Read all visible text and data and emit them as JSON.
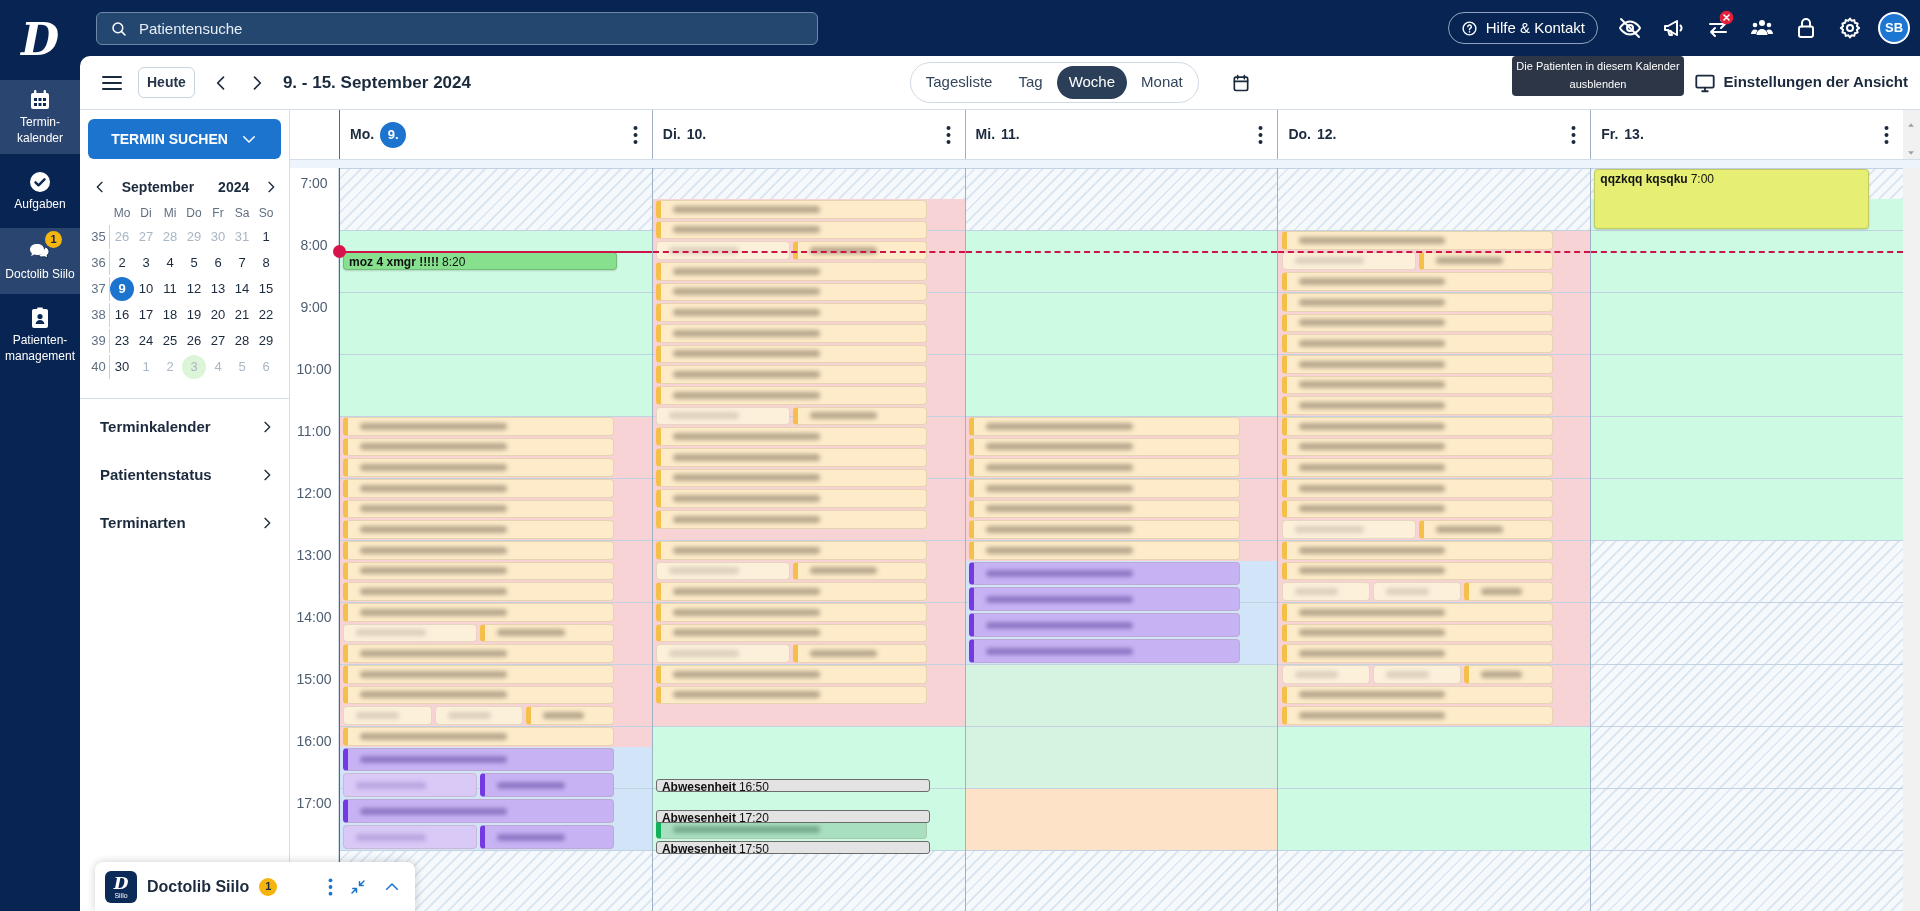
{
  "nav": {
    "logo": "D"
  },
  "nav_items": [
    {
      "kind": "calendar",
      "label": "Termin-\nkalender",
      "selected": true
    },
    {
      "kind": "tasks",
      "label": "Aufgaben",
      "selected": false
    },
    {
      "kind": "chat",
      "label": "Doctolib Siilo",
      "selected": true,
      "badge": "1"
    },
    {
      "kind": "patients",
      "label": "Patienten-\nmanagement",
      "selected": false
    }
  ],
  "search": {
    "placeholder": "Patientensuche"
  },
  "help_button": {
    "label": "Hilfe & Kontakt"
  },
  "header_icons": [
    {
      "kind": "eye-off",
      "alert": false
    },
    {
      "kind": "megaphone",
      "alert": false
    },
    {
      "kind": "swap",
      "alert": true
    },
    {
      "kind": "team",
      "alert": false
    },
    {
      "kind": "lock",
      "alert": false
    },
    {
      "kind": "settings",
      "alert": false
    }
  ],
  "avatar": {
    "initials": "SB"
  },
  "tooltip": {
    "lines": [
      "Die Patienten in diesem Kalender",
      "ausblenden"
    ]
  },
  "toolbar": {
    "today_button": "Heute",
    "range_title": "9. - 15. September 2024",
    "views": [
      {
        "label": "Tagesliste",
        "selected": false
      },
      {
        "label": "Tag",
        "selected": false
      },
      {
        "label": "Woche",
        "selected": true
      },
      {
        "label": "Monat",
        "selected": false
      }
    ],
    "view_settings": "Einstellungen der Ansicht"
  },
  "search_button": {
    "label": "TERMIN SUCHEN"
  },
  "mini_calendar": {
    "month": "September",
    "year": "2024",
    "weekdays": [
      "Mo",
      "Di",
      "Mi",
      "Do",
      "Fr",
      "Sa",
      "So"
    ],
    "weeks": [
      {
        "number": "35",
        "days": [
          {
            "label": "26",
            "outside": true,
            "selected": false,
            "highlighted": false
          },
          {
            "label": "27",
            "outside": true,
            "selected": false,
            "highlighted": false
          },
          {
            "label": "28",
            "outside": true,
            "selected": false,
            "highlighted": false
          },
          {
            "label": "29",
            "outside": true,
            "selected": false,
            "highlighted": false
          },
          {
            "label": "30",
            "outside": true,
            "selected": false,
            "highlighted": false
          },
          {
            "label": "31",
            "outside": true,
            "selected": false,
            "highlighted": false
          },
          {
            "label": "1",
            "outside": false,
            "selected": false,
            "highlighted": false
          }
        ]
      },
      {
        "number": "36",
        "days": [
          {
            "label": "2",
            "outside": false,
            "selected": false,
            "highlighted": false
          },
          {
            "label": "3",
            "outside": false,
            "selected": false,
            "highlighted": false
          },
          {
            "label": "4",
            "outside": false,
            "selected": false,
            "highlighted": false
          },
          {
            "label": "5",
            "outside": false,
            "selected": false,
            "highlighted": false
          },
          {
            "label": "6",
            "outside": false,
            "selected": false,
            "highlighted": false
          },
          {
            "label": "7",
            "outside": false,
            "selected": false,
            "highlighted": false
          },
          {
            "label": "8",
            "outside": false,
            "selected": false,
            "highlighted": false
          }
        ]
      },
      {
        "number": "37",
        "days": [
          {
            "label": "9",
            "outside": false,
            "selected": true,
            "highlighted": false
          },
          {
            "label": "10",
            "outside": false,
            "selected": false,
            "highlighted": false
          },
          {
            "label": "11",
            "outside": false,
            "selected": false,
            "highlighted": false
          },
          {
            "label": "12",
            "outside": false,
            "selected": false,
            "highlighted": false
          },
          {
            "label": "13",
            "outside": false,
            "selected": false,
            "highlighted": false
          },
          {
            "label": "14",
            "outside": false,
            "selected": false,
            "highlighted": false
          },
          {
            "label": "15",
            "outside": false,
            "selected": false,
            "highlighted": false
          }
        ]
      },
      {
        "number": "38",
        "days": [
          {
            "label": "16",
            "outside": false,
            "selected": false,
            "highlighted": false
          },
          {
            "label": "17",
            "outside": false,
            "selected": false,
            "highlighted": false
          },
          {
            "label": "18",
            "outside": false,
            "selected": false,
            "highlighted": false
          },
          {
            "label": "19",
            "outside": false,
            "selected": false,
            "highlighted": false
          },
          {
            "label": "20",
            "outside": false,
            "selected": false,
            "highlighted": false
          },
          {
            "label": "21",
            "outside": false,
            "selected": false,
            "highlighted": false
          },
          {
            "label": "22",
            "outside": false,
            "selected": false,
            "highlighted": false
          }
        ]
      },
      {
        "number": "39",
        "days": [
          {
            "label": "23",
            "outside": false,
            "selected": false,
            "highlighted": false
          },
          {
            "label": "24",
            "outside": false,
            "selected": false,
            "highlighted": false
          },
          {
            "label": "25",
            "outside": false,
            "selected": false,
            "highlighted": false
          },
          {
            "label": "26",
            "outside": false,
            "selected": false,
            "highlighted": false
          },
          {
            "label": "27",
            "outside": false,
            "selected": false,
            "highlighted": false
          },
          {
            "label": "28",
            "outside": false,
            "selected": false,
            "highlighted": false
          },
          {
            "label": "29",
            "outside": false,
            "selected": false,
            "highlighted": false
          }
        ]
      },
      {
        "number": "40",
        "days": [
          {
            "label": "30",
            "outside": false,
            "selected": false,
            "highlighted": false
          },
          {
            "label": "1",
            "outside": true,
            "selected": false,
            "highlighted": false
          },
          {
            "label": "2",
            "outside": true,
            "selected": false,
            "highlighted": false
          },
          {
            "label": "3",
            "outside": true,
            "selected": false,
            "highlighted": true
          },
          {
            "label": "4",
            "outside": true,
            "selected": false,
            "highlighted": false
          },
          {
            "label": "5",
            "outside": true,
            "selected": false,
            "highlighted": false
          },
          {
            "label": "6",
            "outside": true,
            "selected": false,
            "highlighted": false
          }
        ]
      }
    ]
  },
  "sections": [
    {
      "label": "Terminkalender"
    },
    {
      "label": "Patientenstatus"
    },
    {
      "label": "Terminarten"
    }
  ],
  "calendar": {
    "hours": [
      "7:00",
      "8:00",
      "9:00",
      "10:00",
      "11:00",
      "12:00",
      "13:00",
      "14:00",
      "15:00",
      "16:00",
      "17:00"
    ],
    "days": [
      {
        "weekday": "Mo.",
        "date": "9.",
        "today": true,
        "events": [
          {
            "kind": "note",
            "color": "#86e08e",
            "title": "moz 4 xmgr !!!!!",
            "time": "8:20"
          }
        ]
      },
      {
        "weekday": "Di.",
        "date": "10.",
        "today": false,
        "events": [
          {
            "kind": "absence",
            "title": "Abwesenheit",
            "time": "16:50"
          },
          {
            "kind": "absence",
            "title": "Abwesenheit",
            "time": "17:20"
          },
          {
            "kind": "absence",
            "title": "Abwesenheit",
            "time": "17:50"
          }
        ]
      },
      {
        "weekday": "Mi.",
        "date": "11.",
        "today": false
      },
      {
        "weekday": "Do.",
        "date": "12.",
        "today": false
      },
      {
        "weekday": "Fr.",
        "date": "13.",
        "today": false,
        "events": [
          {
            "kind": "note",
            "color": "#e6ee74",
            "title": "qqzkqq kqsqku",
            "time": "7:00"
          }
        ]
      }
    ]
  },
  "siilo_widget": {
    "logo": "D",
    "logo_caption": "Siilo",
    "title": "Doctolib Siilo",
    "badge": "1"
  }
}
